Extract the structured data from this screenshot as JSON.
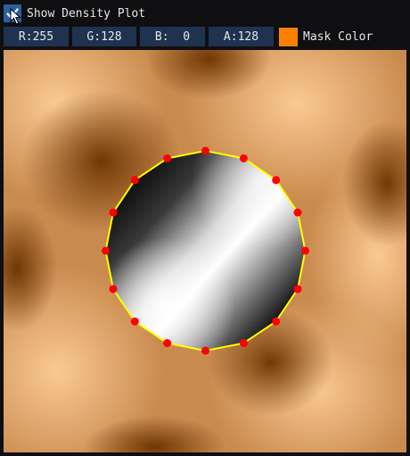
{
  "controls": {
    "show_density": {
      "label": "Show Density Plot",
      "checked": true,
      "icon": "checkmark-icon"
    },
    "cursor_icon": "pointer-cursor-icon",
    "channels": [
      {
        "label": "R:255",
        "name": "red"
      },
      {
        "label": "G:128",
        "name": "green"
      },
      {
        "label": "B:  0",
        "name": "blue"
      },
      {
        "label": "A:128",
        "name": "alpha"
      }
    ],
    "mask_color": {
      "label": "Mask Color",
      "hex": "#ff8000"
    }
  },
  "density_plot": {
    "polygon_vertex_count": 16,
    "colors": {
      "field_light": "#ffc48a",
      "field_dark": "#7a3e06",
      "polygon_edge": "#ffff00",
      "vertex": "#ff0000",
      "mask_light": "#ffffff",
      "mask_dark": "#000000"
    }
  }
}
